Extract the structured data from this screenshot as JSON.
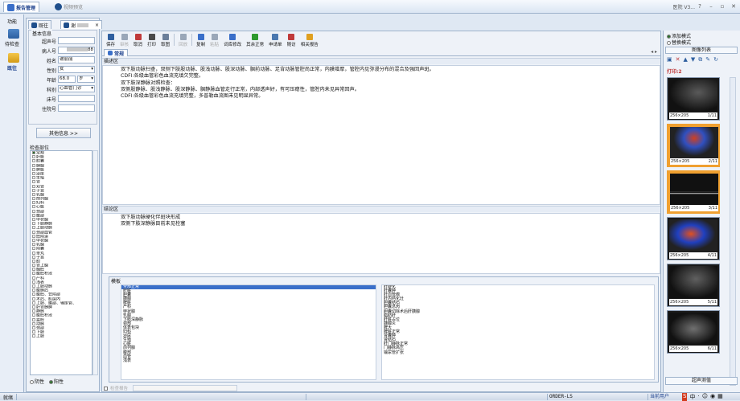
{
  "topbar": {
    "tab_report": "报告管理",
    "tab_preview": "视频预览",
    "right_text": "医院 V3...",
    "colors": {
      "accent": "#1a3f8c",
      "bar": "#dbe6f3"
    }
  },
  "leftnav": {
    "header": "功能",
    "item1": "待检查",
    "item2": "既往"
  },
  "patient_tabs": {
    "tab1": "既往",
    "tab2": "谢",
    "close": "×"
  },
  "basic_info": {
    "title": "基本信息",
    "fields": {
      "ultrasound_no_label": "超声号",
      "ultrasound_no_value": "",
      "patient_id_label": "病人号",
      "patient_id_value": "88",
      "name_label": "姓名",
      "name_value": "谢丽丽",
      "sex_label": "性别",
      "sex_value": "女",
      "age_label": "年龄",
      "age_value": "68.0",
      "age_unit": "岁",
      "dept_label": "科别",
      "dept_value": "心血管门诊",
      "bed_label": "床号",
      "bed_value": "",
      "inpatient_label": "住院号",
      "inpatient_value": ""
    },
    "other_info_button": "其他信息 >>"
  },
  "exam_section": {
    "title": "检查部位",
    "items": [
      "常规",
      "肝脏",
      "胆囊",
      "胰腺",
      "脾脏",
      "泌尿",
      "生殖",
      "肾",
      "双肾",
      "子宫",
      "乳腺",
      "前列腺",
      "妇科",
      "心脏",
      "颈部",
      "腹部",
      "甲状腺",
      "下肢静脉",
      "上肢动脉",
      "颈部血管",
      "经阴道",
      "甲状腺",
      "乳腺",
      "阴囊",
      "睾丸",
      "子宫",
      "胆",
      "肾上腺",
      "胸腔",
      "腹腔积液",
      "产科",
      "浅表",
      "上肢动脉",
      "腹膜后",
      "腹腔、会阴部",
      "术后、肌层内",
      "上肢、腰部、输尿管、",
      "肝肾胰脾",
      "静脉",
      "腹腔积液",
      "盆腔",
      "动脉",
      "颈部",
      "下肢",
      "上肢"
    ],
    "radio_negative": "阴性",
    "radio_positive": "阳性"
  },
  "toolbar": {
    "items": [
      {
        "label": "保存",
        "color": "#2f5f9f",
        "enabled": true
      },
      {
        "label": "审核",
        "color": "#9aa7b8",
        "enabled": false
      },
      {
        "label": "取消",
        "color": "#c03a3a",
        "enabled": true
      },
      {
        "label": "打印",
        "color": "#4a4a4a",
        "enabled": true
      },
      {
        "label": "取图",
        "color": "#6b7f9a",
        "enabled": true
      },
      {
        "label": "回放",
        "color": "#9aa7b8",
        "enabled": false
      },
      {
        "label": "复制",
        "color": "#3a6fc9",
        "enabled": true
      },
      {
        "label": "粘贴",
        "color": "#9aa7b8",
        "enabled": false
      },
      {
        "label": "词库修改",
        "color": "#3a6fc9",
        "enabled": true
      },
      {
        "label": "其余正常",
        "color": "#2e9a2e",
        "enabled": true
      },
      {
        "label": "申请单",
        "color": "#4a78b0",
        "enabled": true
      },
      {
        "label": "随访",
        "color": "#c03a3a",
        "enabled": true
      },
      {
        "label": "相关报告",
        "color": "#e0a020",
        "enabled": true
      }
    ]
  },
  "normal_tab": "常规",
  "description": {
    "label": "描述区",
    "lines": [
      "双下肢动脉扫查，双侧下肢股动脉、股浅动脉、股深动脉、腘前动脉、足背动脉管腔尚正常，内膜增厚，管腔内见弥漫分布的混合及强回声斑。",
      "CDFI:各级血管彩色血流充填欠完整。",
      "双下肢深静脉对照检查：",
      "双侧股静脉、股浅静脉、股深静脉、腘静脉血管走行正常，内部透声好，有可压瘪性，管腔内未见异常回声。",
      "CDFI:各级血管彩色血流充填完整，多普勒血流图未见明显异常。"
    ]
  },
  "conclusion": {
    "label": "结论区",
    "lines": [
      "双下肢动脉硬化伴斑块形成",
      "双侧下肢深静脉目前未见栓塞"
    ]
  },
  "template": {
    "label": "模板",
    "left_items": [
      "全部正常",
      "肝脏",
      "胆囊",
      "胰腺",
      "脾脏",
      "产科",
      "甲状腺",
      "乳腺",
      "下肢深静脉",
      "颈部",
      "体表包块",
      "妇科",
      "泌尿",
      "生殖",
      "心脏",
      "前列腺",
      "腹部",
      "血管",
      "浅表"
    ],
    "right_items": [
      "肝硬化",
      "肝囊肿",
      "肝血管瘤",
      "肝内钙化灶",
      "胆囊结石",
      "胆囊息肉",
      "胆囊切除术后肝胰腺",
      "脂肪肝",
      "肝脏占位",
      "胰腺炎",
      "脾大",
      "脾脏正常",
      "肾囊肿",
      "肾结石",
      "肝门静脉正常",
      "门静脉高压",
      "输尿管扩张"
    ],
    "footer_checkbox": "检查报告"
  },
  "right_panel": {
    "mode_add": "添加模式",
    "mode_replace": "替换模式",
    "image_list_title": "图像列表",
    "print_count": "打印:2",
    "thumbnails": [
      {
        "size": "256×205",
        "index": "1/11",
        "selected": false
      },
      {
        "size": "256×205",
        "index": "2/11",
        "selected": true
      },
      {
        "size": "256×205",
        "index": "3/11",
        "selected": true
      },
      {
        "size": "256×205",
        "index": "4/11",
        "selected": false
      },
      {
        "size": "256×205",
        "index": "5/11",
        "selected": false
      },
      {
        "size": "256×205",
        "index": "6/11",
        "selected": false
      }
    ],
    "measure_button": "超声测值"
  },
  "statusbar": {
    "left": "就绪",
    "order": "ORDER-LS",
    "right": "当前用户"
  }
}
